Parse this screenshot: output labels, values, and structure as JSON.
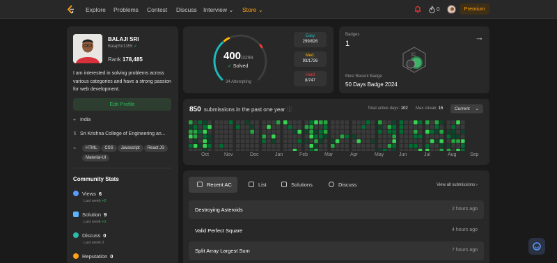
{
  "nav": {
    "links": [
      "Explore",
      "Problems",
      "Contest",
      "Discuss",
      "Interview",
      "Store"
    ],
    "streak": "0",
    "premium": "Premium"
  },
  "profile": {
    "name": "BALAJI SRI",
    "username": "BalajiSri1355",
    "rank_label": "Rank",
    "rank": "178,485",
    "bio": "I am interested in solving problems across various categories and have a strong passion for web development.",
    "edit": "Edit Profile",
    "location": "India",
    "college": "Sri Krishna College of Engineering an...",
    "skills": [
      "HTML",
      "CSS",
      "Javascript",
      "React JS",
      "Material-UI"
    ]
  },
  "community": {
    "title": "Community Stats",
    "stats": [
      {
        "label": "Views",
        "value": "6",
        "last": "Last week",
        "delta": "+2",
        "color": "#5a9bff"
      },
      {
        "label": "Solution",
        "value": "9",
        "last": "Last week",
        "delta": "+1",
        "color": "#5ab4ff"
      },
      {
        "label": "Discuss",
        "value": "0",
        "last": "Last week",
        "delta": "0",
        "color": "#2cbbaa"
      },
      {
        "label": "Reputation",
        "value": "0",
        "last": "",
        "delta": "",
        "color": "#ffa116"
      }
    ]
  },
  "solved": {
    "count": "400",
    "total": "/3299",
    "label": "Solved",
    "attempting": "34 Attempting",
    "easy": {
      "label": "Easy",
      "value": "299/826",
      "color": "#1cbaba",
      "fraction": 0.362
    },
    "medium": {
      "label": "Med.",
      "value": "93/1726",
      "color": "#ffb700",
      "fraction": 0.054
    },
    "hard": {
      "label": "Hard",
      "value": "8/747",
      "color": "#f63737",
      "fraction": 0.011
    }
  },
  "badges": {
    "label": "Badges",
    "count": "1",
    "recent_label": "Most Recent Badge",
    "recent_name": "50 Days Badge 2024"
  },
  "submissions": {
    "count": "850",
    "text": "submissions in the past one year",
    "active_label": "Total active days:",
    "active_days": "102",
    "streak_label": "Max streak:",
    "max_streak": "15",
    "period": "Current",
    "months": [
      "Oct",
      "Nov",
      "Dec",
      "Jan",
      "Feb",
      "Mar",
      "Apr",
      "May",
      "Jun",
      "Jul",
      "Aug",
      "Sep"
    ]
  },
  "list": {
    "tabs": [
      "Recent AC",
      "List",
      "Solutions",
      "Discuss"
    ],
    "view_all": "View all submissions",
    "rows": [
      {
        "title": "Destroying Asteroids",
        "time": "2 hours ago"
      },
      {
        "title": "Valid Perfect Square",
        "time": "4 hours ago"
      },
      {
        "title": "Split Array Largest Sum",
        "time": "7 hours ago"
      }
    ]
  }
}
